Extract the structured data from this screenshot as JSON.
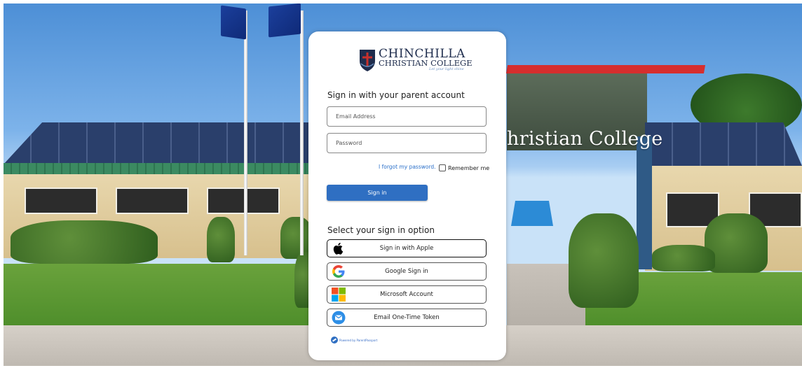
{
  "brand": {
    "name_line1": "CHINCHILLA",
    "name_line2": "CHRISTIAN COLLEGE",
    "tagline": "Let your light shine"
  },
  "background": {
    "building_sign": "hristian College"
  },
  "login": {
    "heading": "Sign in with your parent account",
    "email_placeholder": "Email Address",
    "password_placeholder": "Password",
    "forgot_label": "I forgot my password.",
    "remember_label": "Remember me",
    "remember_checked": false,
    "signin_label": "Sign in"
  },
  "options": {
    "heading": "Select your sign in option",
    "items": [
      {
        "label": "Sign in with Apple",
        "icon": "apple-icon"
      },
      {
        "label": "Google Sign in",
        "icon": "google-icon"
      },
      {
        "label": "Microsoft Account",
        "icon": "microsoft-icon"
      },
      {
        "label": "Email One-Time Token",
        "icon": "email-icon"
      }
    ]
  },
  "footer": {
    "powered_by": "Powered by ParentPassport"
  },
  "colors": {
    "primary_button": "#2f6fc2",
    "link": "#2a6fc9",
    "brand_navy": "#1f2d4d"
  }
}
